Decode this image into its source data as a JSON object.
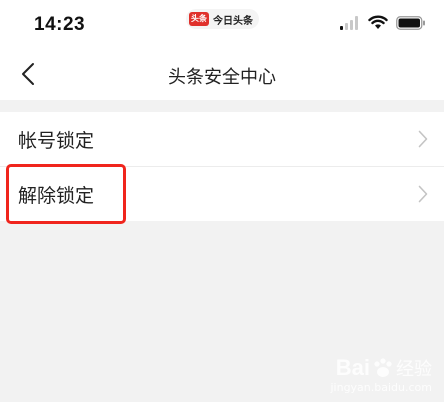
{
  "status_bar": {
    "time": "14:23",
    "app_logo_text": "头条",
    "app_name": "今日头条"
  },
  "nav": {
    "title": "头条安全中心"
  },
  "menu": {
    "items": [
      {
        "label": "帐号锁定"
      },
      {
        "label": "解除锁定"
      }
    ]
  },
  "watermark": {
    "brand": "Bai",
    "brand_suffix": "经验",
    "url": "jingyan.baidu.com"
  },
  "colors": {
    "highlight": "#f0251d",
    "background": "#f2f2f2",
    "app_logo": "#e0312c"
  }
}
